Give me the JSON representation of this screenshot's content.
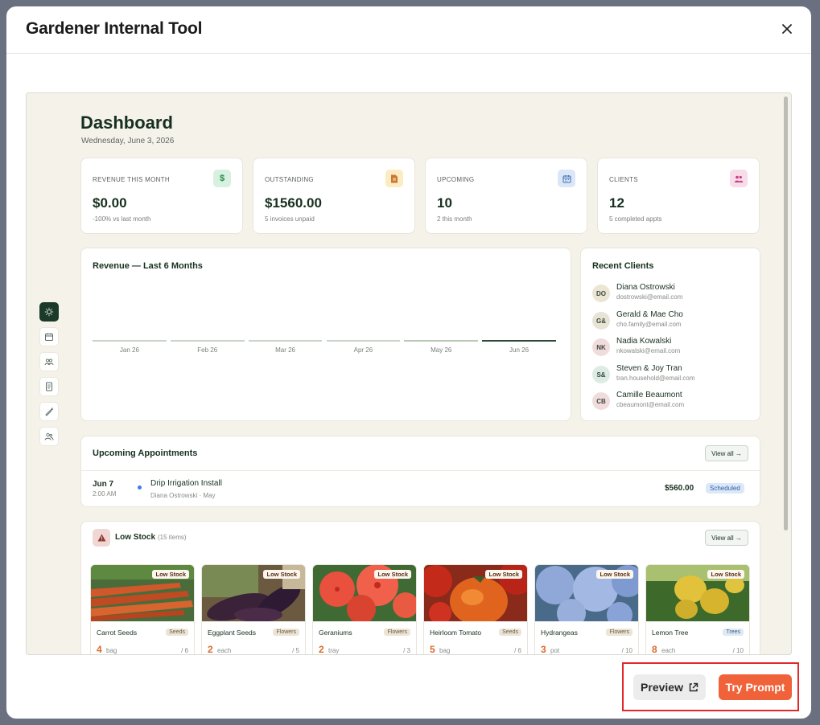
{
  "modal": {
    "title": "Gardener Internal Tool"
  },
  "dashboard": {
    "title": "Dashboard",
    "date": "Wednesday, June 3, 2026"
  },
  "stats": [
    {
      "label": "REVENUE THIS MONTH",
      "value": "$0.00",
      "sub": "-100% vs last month",
      "icon": "dollar-icon",
      "color": "#d8f0df"
    },
    {
      "label": "OUTSTANDING",
      "value": "$1560.00",
      "sub": "5 invoices unpaid",
      "icon": "invoice-icon",
      "color": "#fbecc4"
    },
    {
      "label": "UPCOMING",
      "value": "10",
      "sub": "2 this month",
      "icon": "calendar-icon",
      "color": "#dbe7f7"
    },
    {
      "label": "CLIENTS",
      "value": "12",
      "sub": "5 completed appts",
      "icon": "users-icon",
      "color": "#f8dcea"
    }
  ],
  "revenue_chart": {
    "title": "Revenue — Last 6 Months",
    "chart_data": {
      "type": "bar",
      "categories": [
        "Jan 26",
        "Feb 26",
        "Mar 26",
        "Apr 26",
        "May 26",
        "Jun 26"
      ],
      "values": [
        0,
        0,
        0,
        0,
        0,
        0
      ],
      "highlight": "Jun 26"
    }
  },
  "recent_clients": {
    "title": "Recent Clients",
    "items": [
      {
        "initials": "DO",
        "name": "Diana Ostrowski",
        "email": "dostrowski@email.com",
        "color": "#ece5d3"
      },
      {
        "initials": "G&",
        "name": "Gerald & Mae Cho",
        "email": "cho.family@email.com",
        "color": "#e8e4d5"
      },
      {
        "initials": "NK",
        "name": "Nadia Kowalski",
        "email": "nkowalski@email.com",
        "color": "#f1dcdc"
      },
      {
        "initials": "S&",
        "name": "Steven & Joy Tran",
        "email": "tran.household@email.com",
        "color": "#dcece4"
      },
      {
        "initials": "CB",
        "name": "Camille Beaumont",
        "email": "cbeaumont@email.com",
        "color": "#f1dcdc"
      }
    ]
  },
  "appointments": {
    "title": "Upcoming Appointments",
    "view_all": "View all →",
    "items": [
      {
        "date": "Jun 7",
        "time": "2:00 AM",
        "title": "Drip Irrigation Install",
        "client": "Diana Ostrowski",
        "sep": "·",
        "month": "May",
        "amount": "$560.00",
        "status": "Scheduled"
      }
    ]
  },
  "low_stock": {
    "title": "Low Stock",
    "count": "(15 items)",
    "view_all": "View all →",
    "badge": "Low Stock",
    "items": [
      {
        "name": "Carrot Seeds",
        "category": "Seeds",
        "qty": "4",
        "unit": "bag",
        "max": "/ 6",
        "image": "carrots"
      },
      {
        "name": "Eggplant Seeds",
        "category": "Flowers",
        "qty": "2",
        "unit": "each",
        "max": "/ 5",
        "image": "eggplant"
      },
      {
        "name": "Geraniums",
        "category": "Flowers",
        "qty": "2",
        "unit": "tray",
        "max": "/ 3",
        "image": "geraniums"
      },
      {
        "name": "Heirloom Tomato",
        "category": "Seeds",
        "qty": "5",
        "unit": "bag",
        "max": "/ 6",
        "image": "tomato"
      },
      {
        "name": "Hydrangeas",
        "category": "Flowers",
        "qty": "3",
        "unit": "pot",
        "max": "/ 10",
        "image": "hydrangeas"
      },
      {
        "name": "Lemon Tree",
        "category": "Trees",
        "qty": "8",
        "unit": "each",
        "max": "/ 10",
        "image": "lemons"
      }
    ]
  },
  "footer": {
    "preview_label": "Preview",
    "try_label": "Try Prompt"
  },
  "colors": {
    "brand_green": "#1c3a2a",
    "accent_orange": "#f0623a",
    "highlight_red": "#e2262a"
  }
}
